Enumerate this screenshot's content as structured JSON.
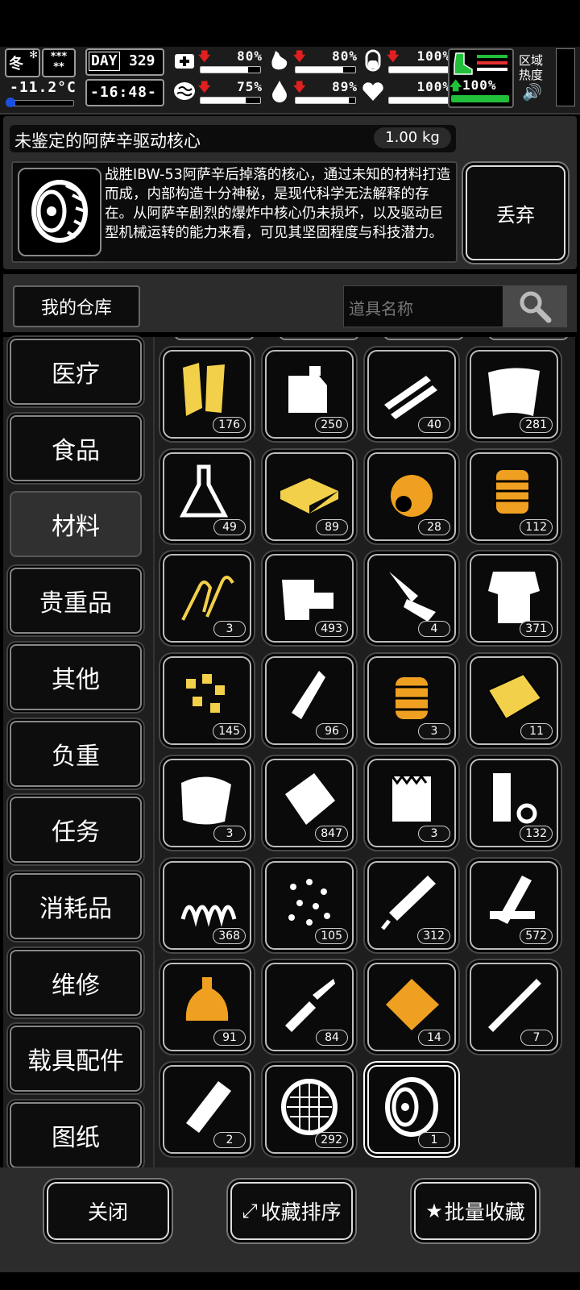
{
  "status": {
    "season": "冬",
    "weather_stars": "***\n**",
    "temperature": "-11.2°C",
    "day_label": "DAY",
    "day_number": "329",
    "clock": "-16:48-",
    "meters": [
      {
        "icon": "medkit-icon",
        "arrow": "down",
        "value": "80%",
        "fill": 0.8
      },
      {
        "icon": "stomach-icon",
        "arrow": "down",
        "value": "80%",
        "fill": 0.8
      },
      {
        "icon": "pill-icon",
        "arrow": "down",
        "value": "100%",
        "fill": 1.0
      },
      {
        "icon": "brain-icon",
        "arrow": "down",
        "value": "75%",
        "fill": 0.75
      },
      {
        "icon": "water-drop-icon",
        "arrow": "down",
        "value": "89%",
        "fill": 0.89
      },
      {
        "icon": "heart-icon",
        "arrow": "none",
        "value": "100%",
        "fill": 1.0
      }
    ],
    "stamina": {
      "arrow": "up",
      "value": "100%",
      "fill": 1.0
    },
    "zone_heat_label": "区域\n热度",
    "colors": {
      "down": "#e02020",
      "up": "#22c03a",
      "bar": "#ffffff",
      "stamina": "#22c03a"
    }
  },
  "item_info": {
    "name": "未鉴定的阿萨辛驱动核心",
    "weight": "1.00 kg",
    "description": "战胜IBW-53阿萨辛后掉落的核心，通过未知的材料打造而成，内部构造十分神秘，是现代科学无法解释的存在。从阿萨辛剧烈的爆炸中核心仍未损坏，以及驱动巨型机械运转的能力来看，可见其坚固程度与科技潜力。",
    "discard_label": "丢弃"
  },
  "warehouse": {
    "title": "我的仓库",
    "search_placeholder": "道具名称"
  },
  "categories": [
    {
      "label": "医疗",
      "active": false
    },
    {
      "label": "食品",
      "active": false
    },
    {
      "label": "材料",
      "active": true
    },
    {
      "label": "贵重品",
      "active": false
    },
    {
      "label": "其他",
      "active": false
    },
    {
      "label": "负重",
      "active": false
    },
    {
      "label": "任务",
      "active": false
    },
    {
      "label": "消耗品",
      "active": false
    },
    {
      "label": "维修",
      "active": false
    },
    {
      "label": "载具配件",
      "active": false
    },
    {
      "label": "图纸",
      "active": false
    }
  ],
  "items": [
    {
      "icon": "wood-planks-icon",
      "count": "176",
      "color": "gold"
    },
    {
      "icon": "jerry-can-icon",
      "count": "250",
      "color": "white"
    },
    {
      "icon": "pipes-icon",
      "count": "40",
      "color": "white"
    },
    {
      "icon": "cloth-sheet-icon",
      "count": "281",
      "color": "white"
    },
    {
      "icon": "flask-icon",
      "count": "49",
      "color": "white"
    },
    {
      "icon": "boards-stack-icon",
      "count": "89",
      "color": "gold"
    },
    {
      "icon": "cable-spool-icon",
      "count": "28",
      "color": "orange"
    },
    {
      "icon": "rope-coil-icon",
      "count": "112",
      "color": "orange"
    },
    {
      "icon": "wire-clips-icon",
      "count": "3",
      "color": "gold"
    },
    {
      "icon": "machine-parts-icon",
      "count": "493",
      "color": "white"
    },
    {
      "icon": "folding-knife-icon",
      "count": "4",
      "color": "white"
    },
    {
      "icon": "torn-shirt-icon",
      "count": "371",
      "color": "white"
    },
    {
      "icon": "nuggets-icon",
      "count": "145",
      "color": "gold"
    },
    {
      "icon": "glue-bottle-icon",
      "count": "96",
      "color": "white"
    },
    {
      "icon": "engine-core-icon",
      "count": "3",
      "color": "orange"
    },
    {
      "icon": "gold-plate-icon",
      "count": "11",
      "color": "gold"
    },
    {
      "icon": "rag-icon",
      "count": "3",
      "color": "white"
    },
    {
      "icon": "bag-icon",
      "count": "847",
      "color": "white"
    },
    {
      "icon": "fur-pelt-icon",
      "count": "3",
      "color": "white"
    },
    {
      "icon": "tube-tape-icon",
      "count": "132",
      "color": "white"
    },
    {
      "icon": "spring-icon",
      "count": "368",
      "color": "white"
    },
    {
      "icon": "beads-icon",
      "count": "105",
      "color": "white"
    },
    {
      "icon": "file-tool-icon",
      "count": "312",
      "color": "white"
    },
    {
      "icon": "broken-planks-icon",
      "count": "572",
      "color": "white"
    },
    {
      "icon": "lantern-bottle-icon",
      "count": "91",
      "color": "orange"
    },
    {
      "icon": "soldering-iron-icon",
      "count": "84",
      "color": "white"
    },
    {
      "icon": "gold-chunk-icon",
      "count": "14",
      "color": "orange"
    },
    {
      "icon": "pen-rod-icon",
      "count": "7",
      "color": "white"
    },
    {
      "icon": "log-icon",
      "count": "2",
      "color": "white"
    },
    {
      "icon": "mesh-filter-icon",
      "count": "292",
      "color": "white"
    },
    {
      "icon": "drive-core-icon",
      "count": "1",
      "color": "white",
      "selected": true
    }
  ],
  "bottom": {
    "close_label": "关闭",
    "sort_label": "收藏排序",
    "batch_label": "批量收藏"
  }
}
